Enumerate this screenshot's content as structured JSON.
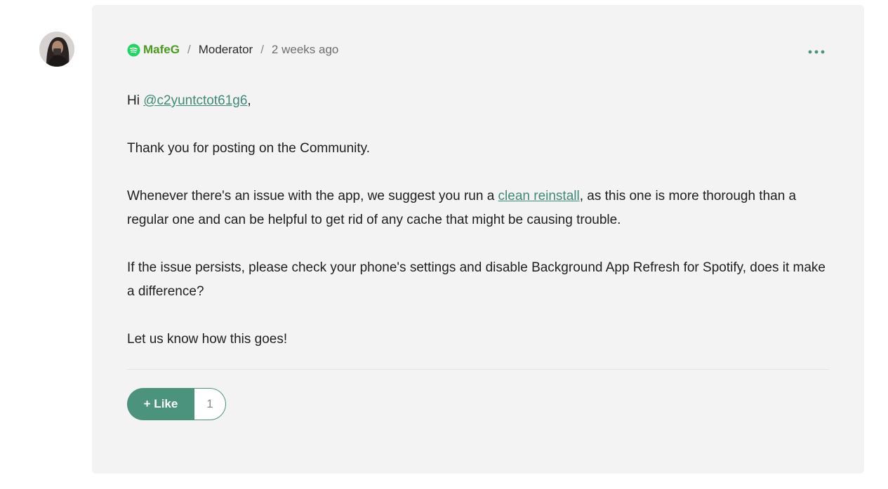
{
  "post": {
    "author": {
      "name": "MafeG",
      "avatar_icon": "user-avatar-photo",
      "badge_icon": "spotify-logo-icon",
      "badge_color": "#1ed760",
      "name_color": "#4b9a1c"
    },
    "separator": "/",
    "role": "Moderator",
    "timestamp": "2 weeks ago",
    "options_icon": "more-options-icon",
    "body": {
      "greeting_prefix": "Hi ",
      "mention": "@c2yuntctot61g6",
      "greeting_suffix": ",",
      "paragraph_1": "Thank you for posting on the Community.",
      "paragraph_2_before": "Whenever there's an issue with the app, we suggest you run a ",
      "paragraph_2_link": "clean reinstall",
      "paragraph_2_after": ", as this one is more thorough than a regular one and can be helpful to get rid of any cache that might be causing trouble.",
      "paragraph_3": "If the issue persists, please check your phone's settings and disable Background App Refresh for Spotify, does it make a difference?",
      "paragraph_4": "Let us know how this goes!"
    },
    "like_button": {
      "label": "+ Like",
      "count": "1"
    }
  },
  "colors": {
    "accent": "#4c937d",
    "link": "#3f8a77",
    "card_background": "#f3f3f3"
  }
}
